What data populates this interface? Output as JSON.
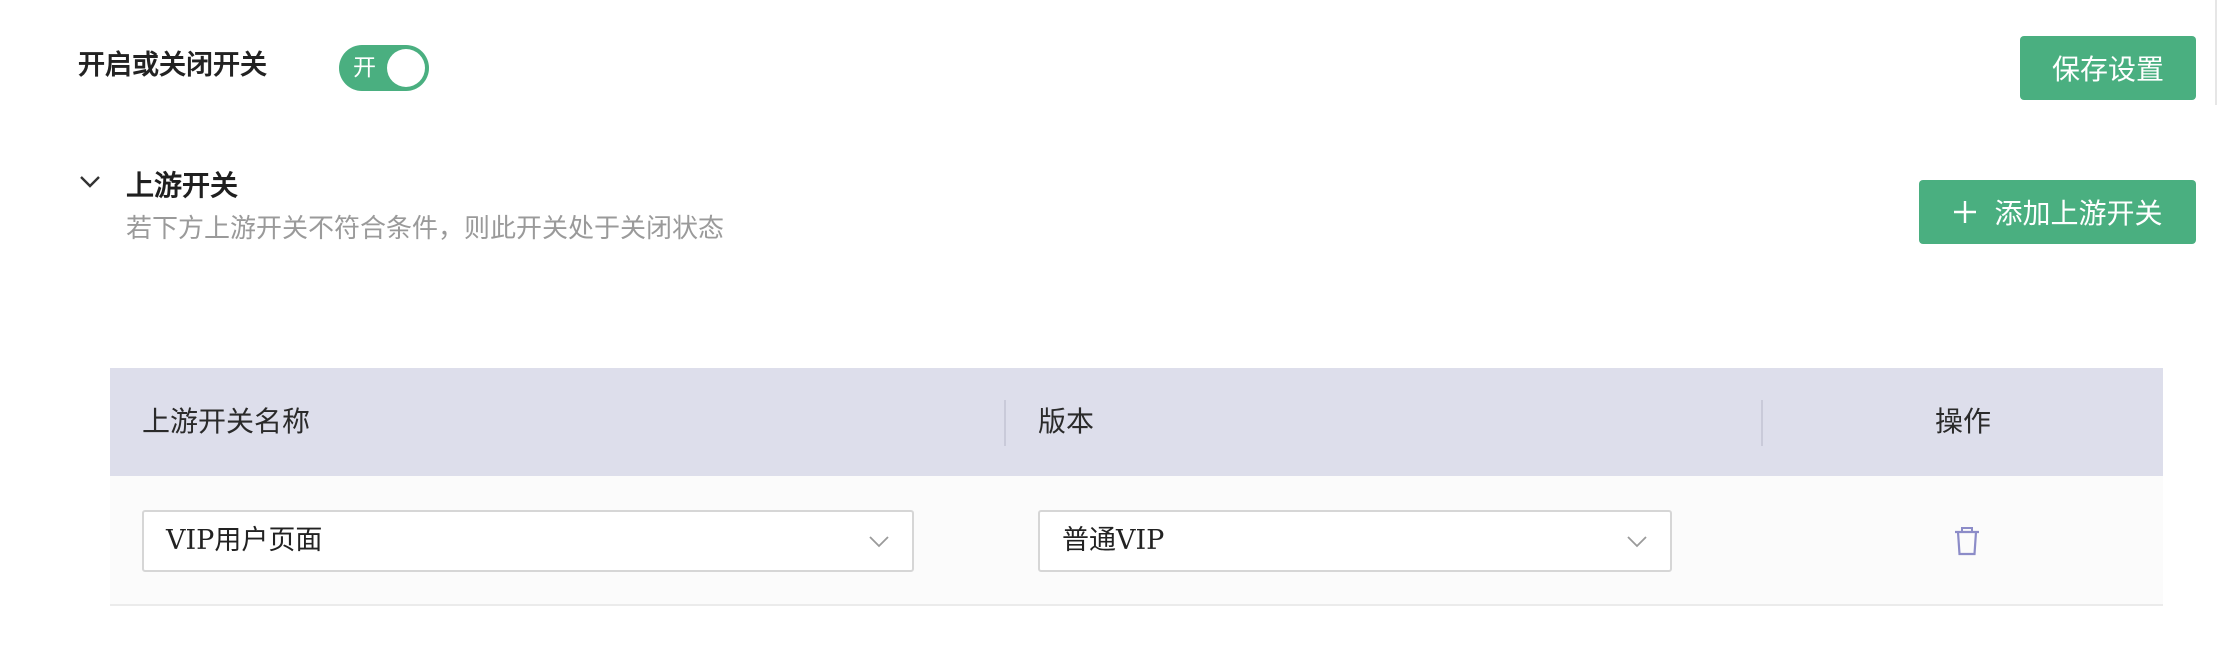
{
  "toggle": {
    "label": "开启或关闭开关",
    "switch_text": "开",
    "state": "on"
  },
  "toolbar": {
    "save_label": "保存设置",
    "add_label": "添加上游开关",
    "add_icon": "plus-icon"
  },
  "section": {
    "title": "上游开关",
    "description": "若下方上游开关不符合条件，则此开关处于关闭状态",
    "collapse_icon": "chevron-down-icon"
  },
  "table": {
    "headers": [
      "上游开关名称",
      "版本",
      "操作"
    ],
    "rows": [
      {
        "name": "VIP用户页面",
        "version": "普通VIP",
        "action_icon": "trash-icon"
      }
    ]
  },
  "colors": {
    "accent": "#4aaf80",
    "header_bg": "#dddeeb",
    "icon": "#8c8cc8"
  }
}
